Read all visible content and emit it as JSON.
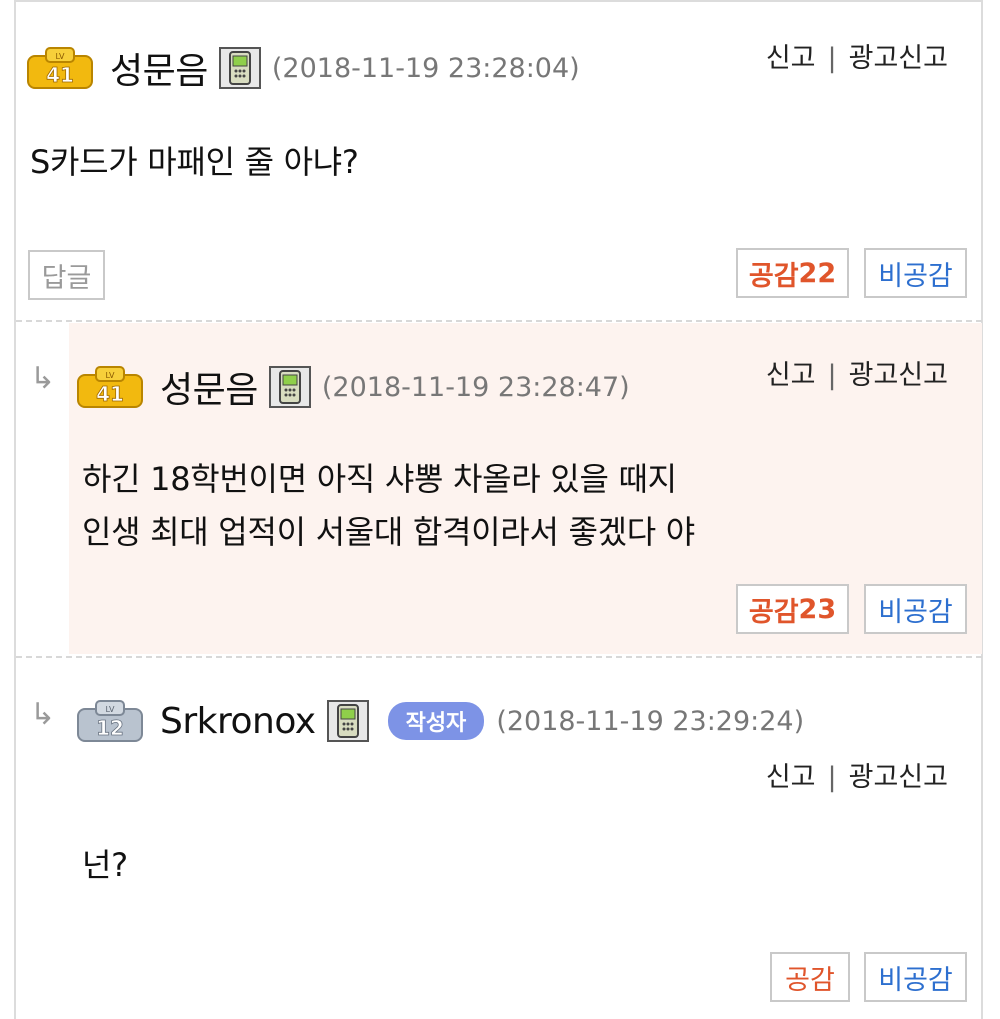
{
  "comments": [
    {
      "level": "41",
      "nickname": "성문음",
      "date": "(2018-11-19 23:28:04)",
      "report": "신고",
      "ad_report": "광고신고",
      "text_lines": [
        "S카드가 마패인 줄 아냐?"
      ],
      "reply_label": "답글",
      "like_label": "공감",
      "like_count": "22",
      "dislike_label": "비공감"
    },
    {
      "level": "41",
      "nickname": "성문음",
      "date": "(2018-11-19 23:28:47)",
      "report": "신고",
      "ad_report": "광고신고",
      "text_lines": [
        "하긴 18학번이면 아직 샤뽕 차올라 있을 때지",
        "인생 최대 업적이 서울대 합격이라서 좋겠다 야"
      ],
      "like_label": "공감",
      "like_count": "23",
      "dislike_label": "비공감"
    },
    {
      "level": "12",
      "nickname": "Srkronox",
      "author_badge": "작성자",
      "date": "(2018-11-19 23:29:24)",
      "report": "신고",
      "ad_report": "광고신고",
      "text_lines": [
        "넌?"
      ],
      "like_label": "공감",
      "dislike_label": "비공감"
    }
  ],
  "reply_arrow": "↳",
  "report_separator": "|",
  "colors": {
    "like": "#e0552b",
    "dislike": "#2d6fcf",
    "reply_bg": "#fdf3ef",
    "badge": "#7d93e6",
    "level_gold": "#f2b90f",
    "level_silver": "#b9c3cf"
  }
}
